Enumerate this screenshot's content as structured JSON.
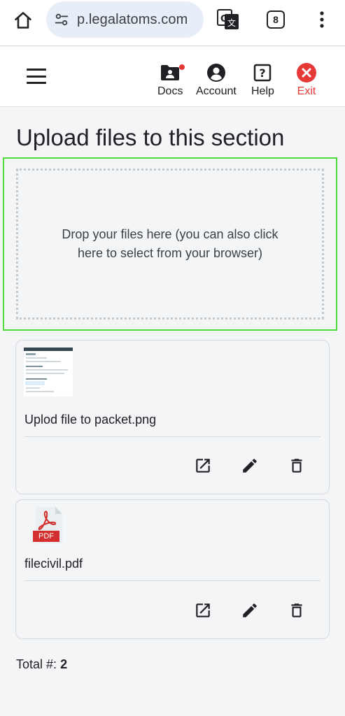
{
  "browser": {
    "url": "p.legalatoms.com",
    "tab_count": "8"
  },
  "nav": {
    "docs_label": "Docs",
    "account_label": "Account",
    "help_label": "Help",
    "exit_label": "Exit"
  },
  "page": {
    "title": "Upload files to this section",
    "dropzone_text": "Drop your files here (you can also click here to select from your browser)"
  },
  "files": [
    {
      "name": "Uplod file to packet.png",
      "type": "image"
    },
    {
      "name": "filecivil.pdf",
      "type": "pdf",
      "badge": "PDF"
    }
  ],
  "total": {
    "label": "Total #:",
    "value": "2"
  },
  "colors": {
    "accent_green": "#4fdc3b",
    "exit_red": "#e53935"
  }
}
